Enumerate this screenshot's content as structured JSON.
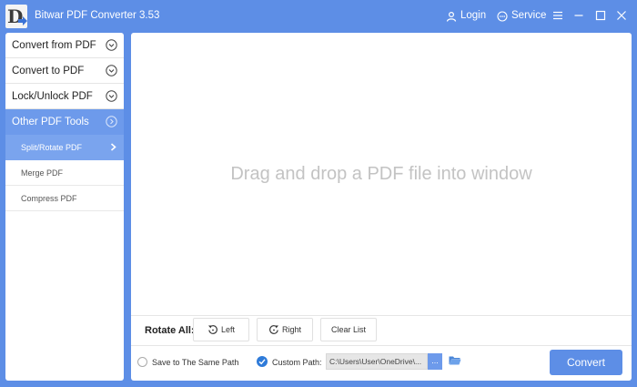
{
  "app": {
    "title": "Bitwar PDF Converter 3.53",
    "logo_letter": "D",
    "login_label": "Login",
    "service_label": "Service"
  },
  "sidebar": {
    "items": [
      {
        "label": "Convert from PDF"
      },
      {
        "label": "Convert to PDF"
      },
      {
        "label": "Lock/Unlock PDF"
      },
      {
        "label": "Other PDF Tools"
      }
    ],
    "subitems": [
      {
        "label": "Split/Rotate PDF"
      },
      {
        "label": "Merge PDF"
      },
      {
        "label": "Compress PDF"
      }
    ]
  },
  "main": {
    "drop_text": "Drag and drop a PDF file into window",
    "rotate_all_label": "Rotate All:",
    "left_label": "Left",
    "right_label": "Right",
    "clear_label": "Clear List",
    "save_same_path_label": "Save to The Same Path",
    "custom_path_label": "Custom Path:",
    "custom_path_value": "C:\\Users\\User\\OneDrive\\...",
    "browse_label": "...",
    "convert_label": "Convert"
  },
  "colors": {
    "accent": "#5d8ee6",
    "active_item": "#6d9aeb",
    "selected_subitem": "#7aa4ee",
    "checkbox_checked": "#2f7bd9"
  },
  "icons": [
    "user-icon",
    "chat-icon",
    "menu-icon",
    "minimize-icon",
    "maximize-icon",
    "close-icon",
    "chevron-down-icon",
    "chevron-right-icon",
    "rotate-left-icon",
    "rotate-right-icon",
    "check-icon",
    "folder-icon"
  ]
}
